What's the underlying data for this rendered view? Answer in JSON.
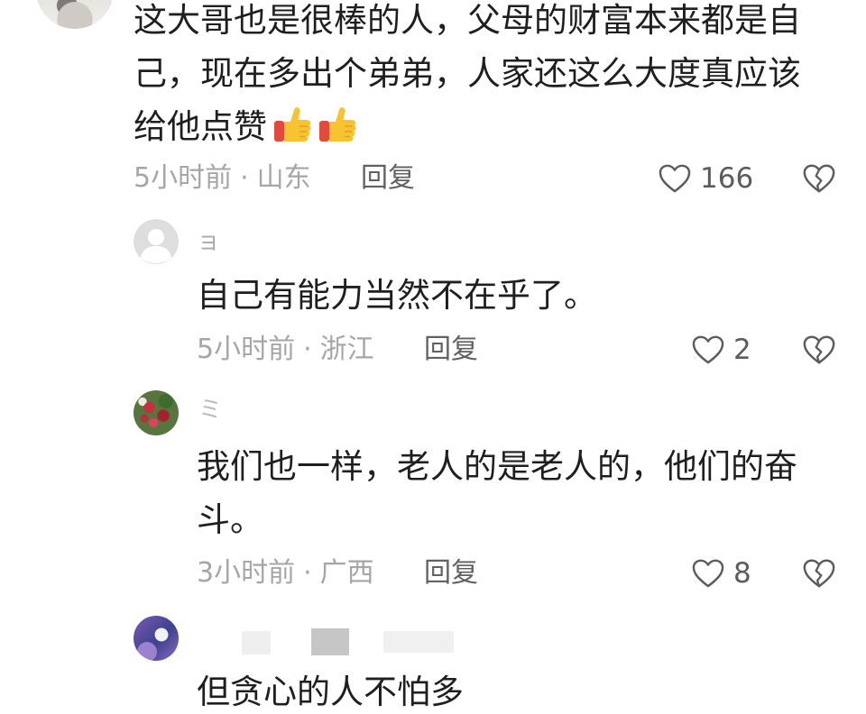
{
  "meta_separator": "·",
  "colors": {
    "background": "#ffffff",
    "text": "#1f1f1f",
    "meta": "#a6a6a6",
    "reply": "#616161",
    "icon": "#5c5c5c",
    "emoji_yellow": "#f8c331",
    "emoji_red": "#e24b3b"
  },
  "icons": {
    "like": "heart-outline-icon",
    "dislike": "broken-heart-icon",
    "emoji": "thumbs-up-icon",
    "default_avatar": "default-user-avatar"
  },
  "comments": [
    {
      "text": "这大哥也是很棒的人，父母的财富本来都是自己，现在多出个弟弟，人家还这么大度真应该给他点赞",
      "emoji": [
        "thumbs-up",
        "thumbs-up"
      ],
      "time": "5小时前",
      "location": "山东",
      "reply_label": "回复",
      "like_count": "166"
    },
    {
      "username": "ョ",
      "text": "自己有能力当然不在乎了。",
      "time": "5小时前",
      "location": "浙江",
      "reply_label": "回复",
      "like_count": "2"
    },
    {
      "username": "ミ",
      "text": "我们也一样，老人的是老人的，他们的奋斗。",
      "time": "3小时前",
      "location": "广西",
      "reply_label": "回复",
      "like_count": "8"
    },
    {
      "username_redacted": true,
      "text": "但贪心的人不怕多"
    }
  ]
}
